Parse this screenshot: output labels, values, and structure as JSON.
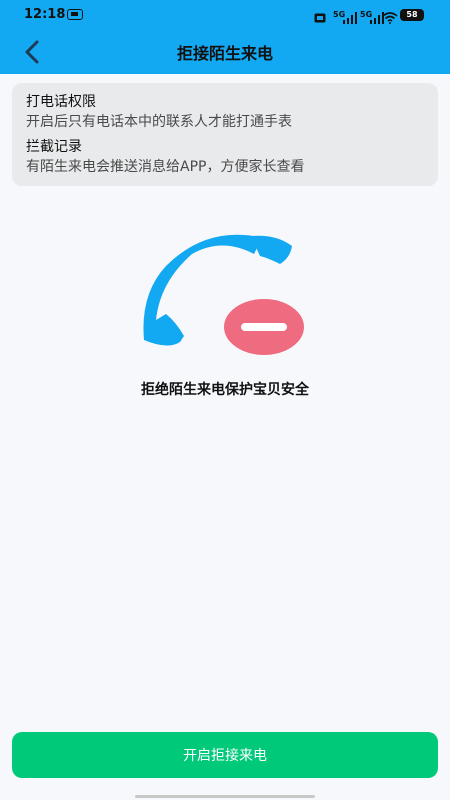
{
  "status_bar": {
    "time": "12:18",
    "network_1": "5G",
    "network_2": "5G",
    "battery": "58"
  },
  "header": {
    "title": "拒接陌生来电"
  },
  "info_card": {
    "items": [
      {
        "title": "打电话权限",
        "description": "开启后只有电话本中的联系人才能打通手表"
      },
      {
        "title": "拦截记录",
        "description": "有陌生来电会推送消息给APP，方便家长查看"
      }
    ]
  },
  "hero": {
    "caption": "拒绝陌生来电保护宝贝安全"
  },
  "action": {
    "button_label": "开启拒接来电"
  },
  "colors": {
    "header_bg": "#12a8f2",
    "phone_icon": "#12a8f2",
    "block_badge": "#ef6b80",
    "button_bg": "#00c97a"
  },
  "icons": {
    "back": "back-arrow-icon",
    "phone": "phone-handset-icon",
    "block": "minus-circle-icon",
    "wifi": "wifi-icon"
  }
}
